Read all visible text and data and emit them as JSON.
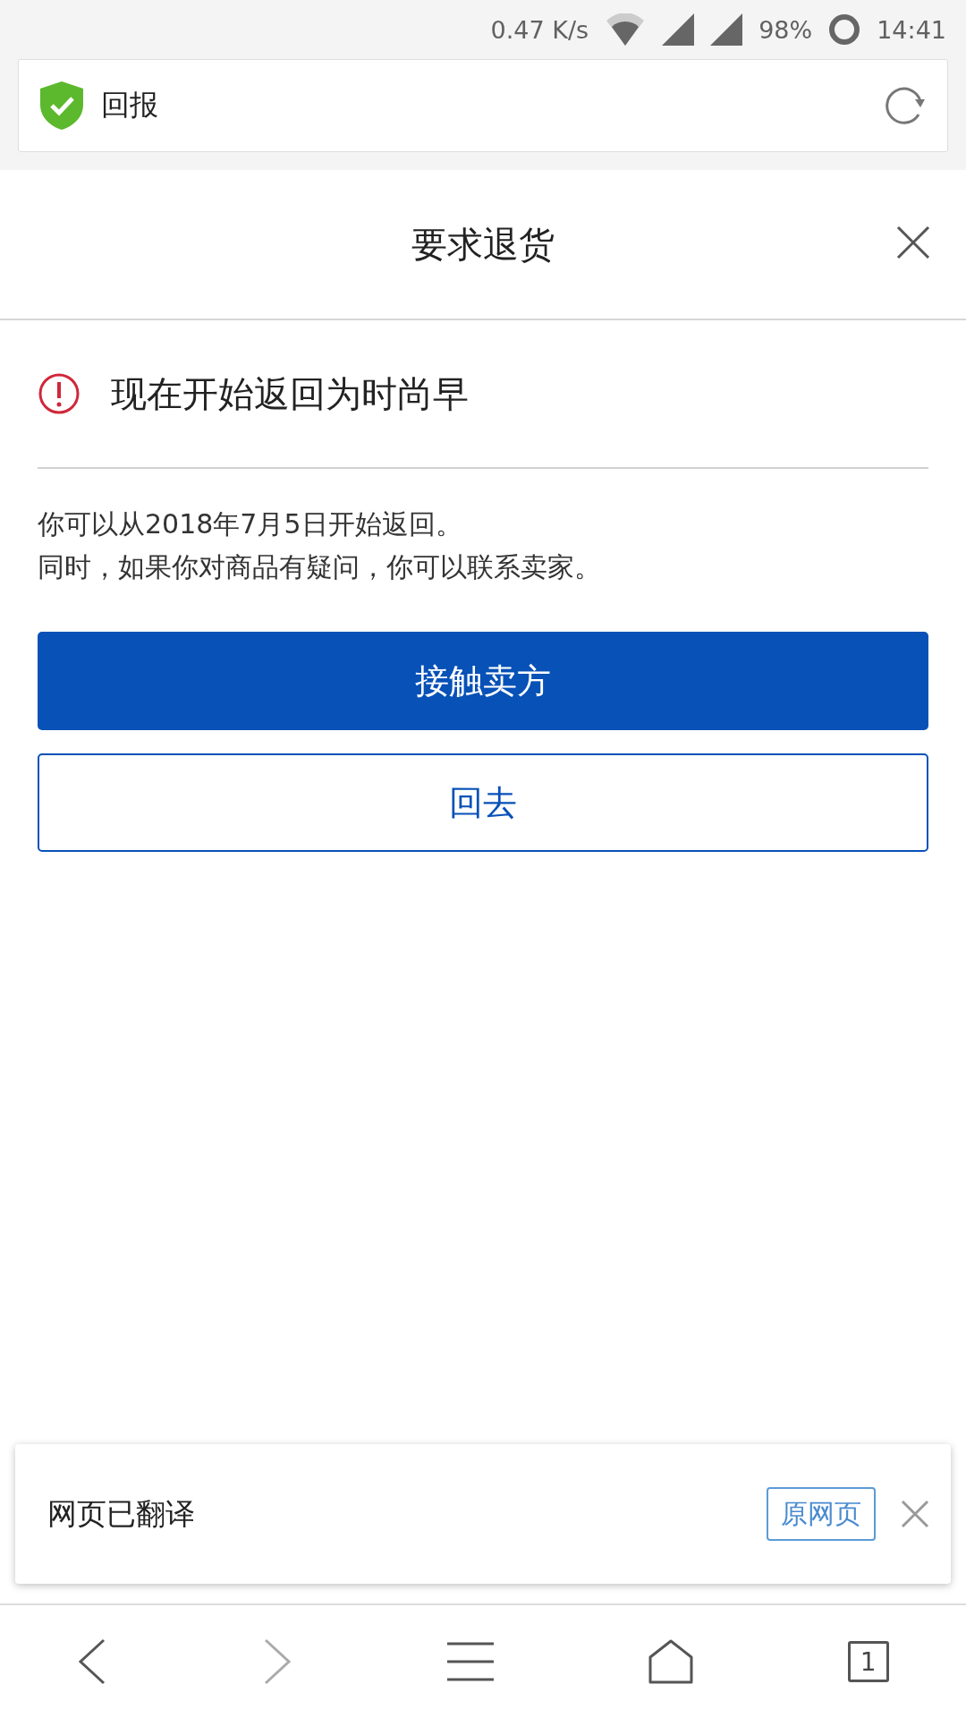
{
  "status_bar": {
    "speed": "0.47 K/s",
    "battery": "98%",
    "time": "14:41"
  },
  "address_bar": {
    "title": "回报"
  },
  "dialog": {
    "title": "要求退货",
    "alert": "现在开始返回为时尚早",
    "lines": [
      "你可以从2018年7月5日开始返回。",
      "同时，如果你对商品有疑问，你可以联系卖家。"
    ],
    "buttons": [
      {
        "label": "接触卖方",
        "kind": "primary"
      },
      {
        "label": "回去",
        "kind": "secondary"
      }
    ]
  },
  "translate_banner": {
    "message": "网页已翻译",
    "button": "原网页"
  },
  "bottom_nav": {
    "tab_count": "1"
  }
}
